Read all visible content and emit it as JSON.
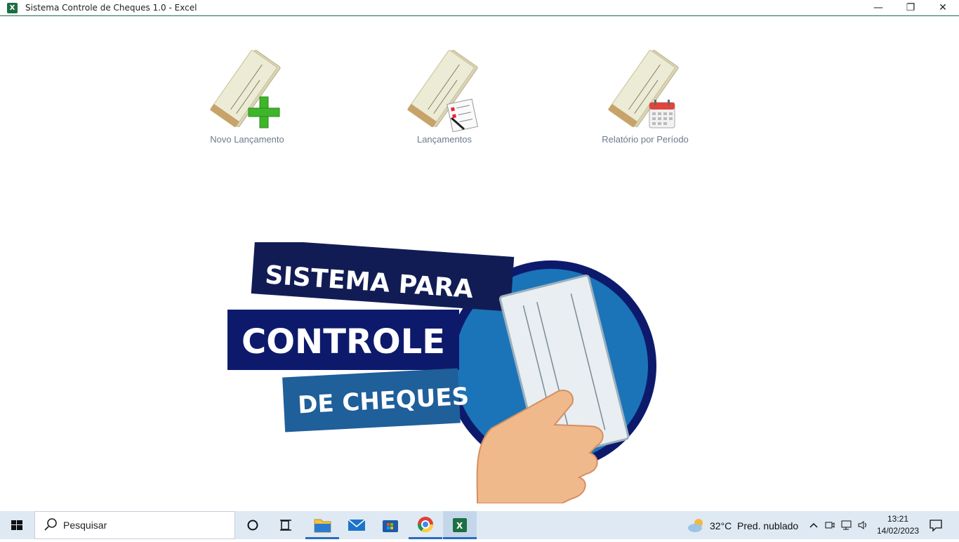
{
  "window": {
    "app_icon": "excel-icon",
    "title": "Sistema Controle de Cheques 1.0 - Excel",
    "controls": {
      "minimize": "—",
      "maximize": "❐",
      "close": "✕"
    }
  },
  "menu": [
    {
      "label": "Novo Lançamento",
      "icon": "check-add-icon"
    },
    {
      "label": "Lançamentos",
      "icon": "check-list-icon"
    },
    {
      "label": "Relatório por Período",
      "icon": "check-calendar-icon"
    }
  ],
  "banner": {
    "line1": "SISTEMA PARA",
    "line2": "CONTROLE",
    "line3": "DE CHEQUES",
    "colors": {
      "dark": "#121c54",
      "navy": "#0d1a6c",
      "blue": "#1f5f9a",
      "circle": "#1b74b8"
    }
  },
  "taskbar": {
    "search_placeholder": "Pesquisar",
    "weather_temp": "32°C",
    "weather_desc": "Pred. nublado",
    "time": "13:21",
    "date": "14/02/2023"
  }
}
